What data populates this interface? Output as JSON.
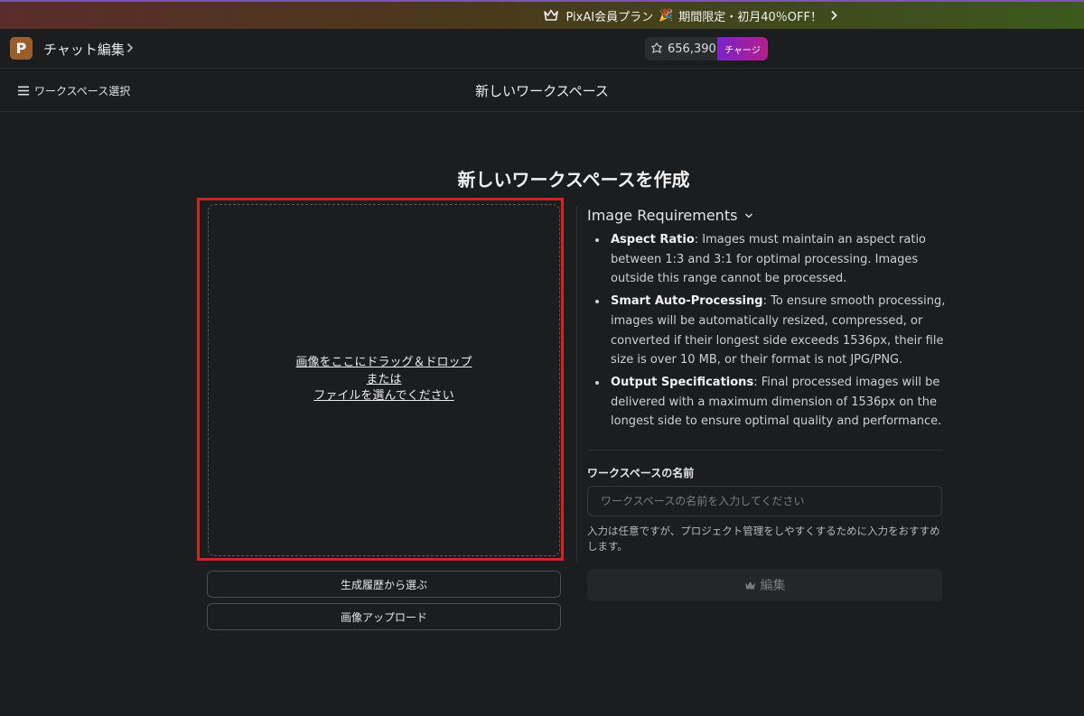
{
  "promo": {
    "text_before": "PixAI会員プラン",
    "emoji": "🎉",
    "text_after": "期間限定・初月40％OFF！"
  },
  "topbar": {
    "app_title": "チャット編集",
    "logo_letter": "P",
    "credits": "656,390",
    "charge_label": "チャージ"
  },
  "subbar": {
    "workspace_select": "ワークスペース選択",
    "page_title": "新しいワークスペース"
  },
  "main": {
    "heading": "新しいワークスペースを作成",
    "dropzone": {
      "line1": "画像をここにドラッグ＆ドロップ",
      "line2": "または",
      "line3": "ファイルを選んでください"
    },
    "btn_history": "生成履歴から選ぶ",
    "btn_upload": "画像アップロード"
  },
  "requirements": {
    "title": "Image Requirements",
    "items": [
      {
        "term": "Aspect Ratio",
        "text": ": Images must maintain an aspect ratio between 1:3 and 3:1 for optimal processing. Images outside this range cannot be processed."
      },
      {
        "term": "Smart Auto-Processing",
        "text": ": To ensure smooth processing, images will be automatically resized, compressed, or converted if their longest side exceeds 1536px, their file size is over 10 MB, or their format is not JPG/PNG."
      },
      {
        "term": "Output Specifications",
        "text": ": Final processed images will be delivered with a maximum dimension of 1536px on the longest side to ensure optimal quality and performance."
      }
    ]
  },
  "workspace_name": {
    "label": "ワークスペースの名前",
    "placeholder": "ワークスペースの名前を入力してください",
    "value": "",
    "hint": "入力は任意ですが、プロジェクト管理をしやすくするために入力をおすすめします。"
  },
  "edit_button": {
    "label": "編集"
  },
  "colors": {
    "background": "#1c1d1f",
    "highlight_border": "#d6231f",
    "charge_gradient_start": "#7a22c9",
    "charge_gradient_end": "#b51f8c",
    "logo": "#9b5d2a"
  },
  "icons": [
    "crown-icon",
    "chevron-right-icon",
    "coin-icon",
    "menu-icon",
    "chevron-down-icon"
  ]
}
